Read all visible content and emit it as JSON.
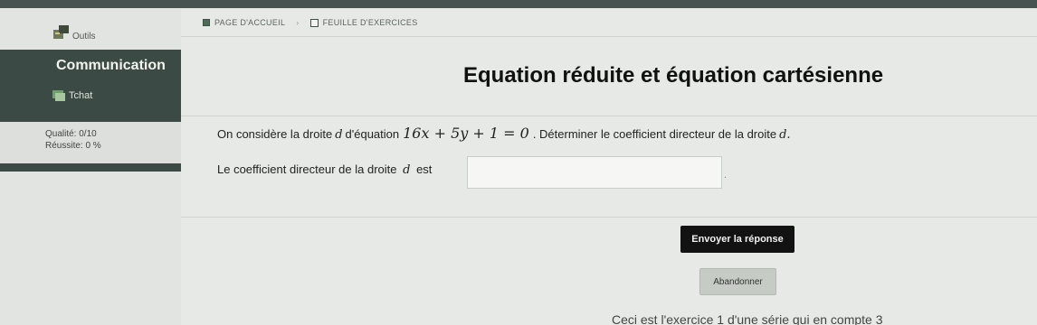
{
  "sidebar": {
    "tools_label": "Outils",
    "section_title": "Communication",
    "chat_label": "Tchat",
    "quality_text": "Qualité: 0/10",
    "success_text": "Réussite: 0 %"
  },
  "breadcrumb": {
    "home": "PAGE D'ACCUEIL",
    "sheet": "FEUILLE D'EXERCICES"
  },
  "exercise": {
    "title": "Equation réduite et équation cartésienne",
    "question_prefix": "On considère la droite",
    "line_name": "d",
    "question_mid": "d'équation",
    "equation": "16x + 5y + 1 = 0",
    "question_suffix": ". Déterminer le coefficient directeur de la droite",
    "question_end": "d.",
    "answer_label": "Le coefficient directeur de la droite",
    "answer_line_name": "d",
    "answer_suffix": "est",
    "answer_value": "",
    "answer_trailing": "."
  },
  "buttons": {
    "submit": "Envoyer la réponse",
    "abandon": "Abandonner"
  },
  "footer": {
    "text": "Ceci est l'exercice 1 d'une série qui en compte 3"
  },
  "icons": {
    "tools": "tools-icon",
    "chat": "chat-icon",
    "home": "home-icon",
    "sheet": "sheet-icon"
  },
  "colors": {
    "sidebar_dark": "#3c4a46",
    "topbar": "#475351",
    "submit_button": "#121212",
    "background": "#e7e9e6"
  }
}
